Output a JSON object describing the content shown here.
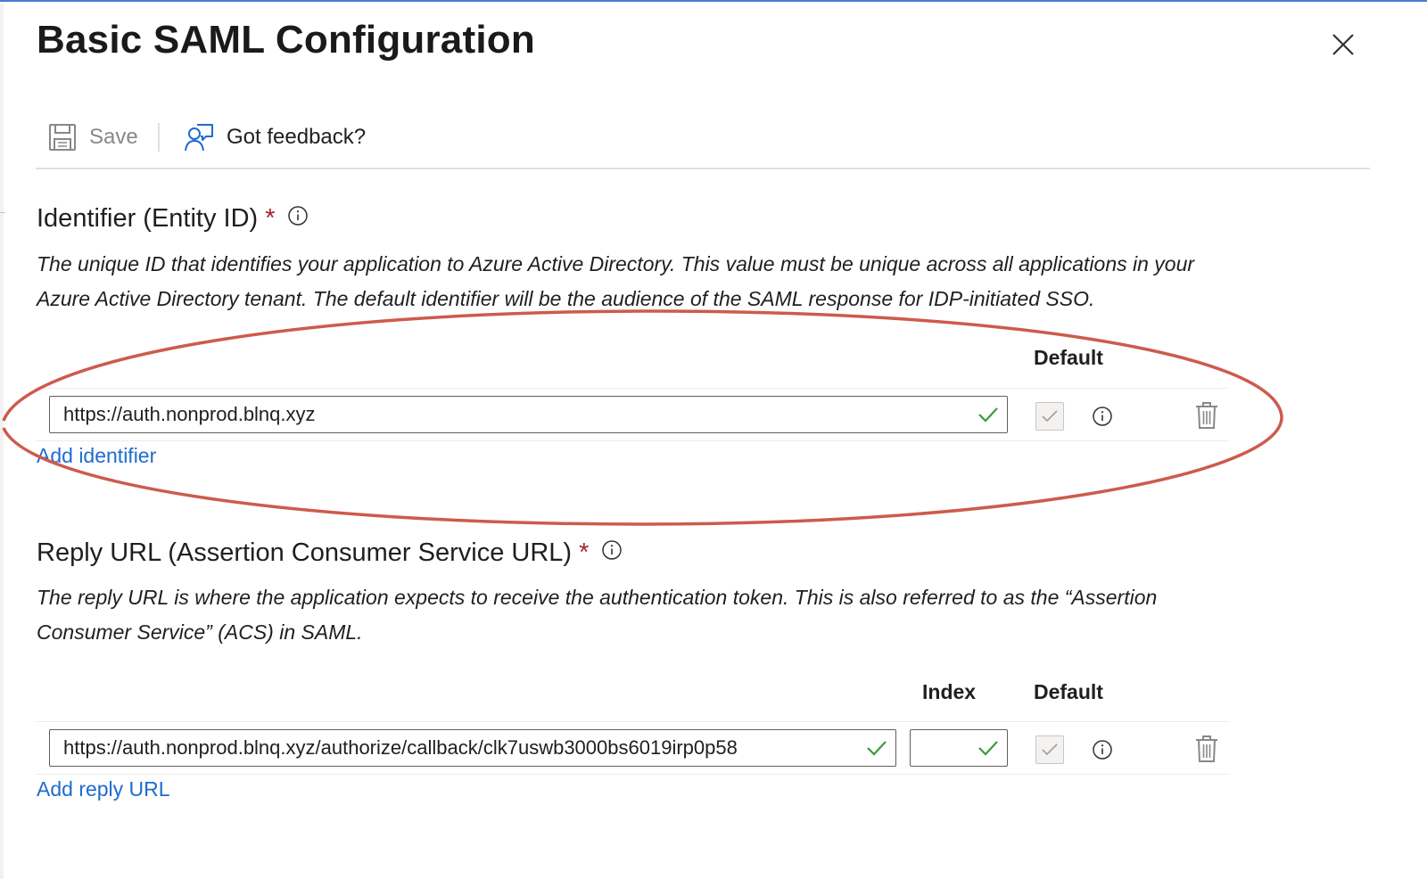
{
  "panel": {
    "title": "Basic SAML Configuration",
    "close_label": "Close"
  },
  "toolbar": {
    "save_label": "Save",
    "feedback_label": "Got feedback?"
  },
  "identifier": {
    "title": "Identifier (Entity ID)",
    "required_mark": "*",
    "description": "The unique ID that identifies your application to Azure Active Directory. This value must be unique across all applications in your Azure Active Directory tenant. The default identifier will be the audience of the SAML response for IDP-initiated SSO.",
    "columns": {
      "default": "Default"
    },
    "rows": [
      {
        "value": "https://auth.nonprod.blnq.xyz",
        "is_default": true
      }
    ],
    "add_link": "Add identifier"
  },
  "reply_url": {
    "title": "Reply URL (Assertion Consumer Service URL)",
    "required_mark": "*",
    "description": "The reply URL is where the application expects to receive the authentication token. This is also referred to as the “Assertion Consumer Service” (ACS) in SAML.",
    "columns": {
      "index": "Index",
      "default": "Default"
    },
    "rows": [
      {
        "value": "https://auth.nonprod.blnq.xyz/authorize/callback/clk7uswb3000bs6019irp0p58",
        "index": "",
        "is_default": true
      }
    ],
    "add_link": "Add reply URL"
  },
  "colors": {
    "accent_link": "#1f6bd1",
    "valid_check": "#3c9b3c",
    "required": "#a4262c",
    "annotation_ellipse": "#cd5b4c",
    "top_border": "#4a7bd0"
  },
  "icons": {
    "save": "save-icon",
    "feedback": "feedback-icon",
    "close": "close-icon",
    "info": "info-icon",
    "check": "check-icon",
    "delete": "trash-icon"
  }
}
